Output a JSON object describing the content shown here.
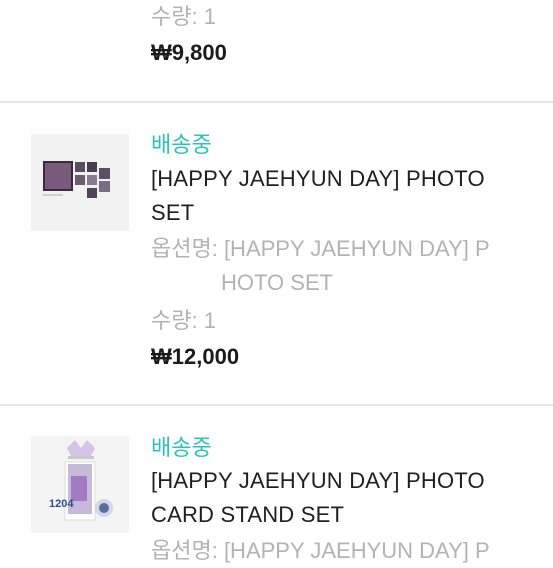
{
  "items": [
    {
      "quantity": "수량: 1",
      "price": "₩9,800"
    },
    {
      "status": "배송중",
      "title_line1": "[HAPPY JAEHYUN DAY] PHOTO",
      "title_line2": "SET",
      "option_line1": "옵션명: [HAPPY JAEHYUN DAY] P",
      "option_line2": "HOTO SET",
      "quantity": "수량: 1",
      "price": "₩12,000",
      "thumbnail_icon": "photo-set-thumbnail"
    },
    {
      "status": "배송중",
      "title_line1": "[HAPPY JAEHYUN DAY] PHOTO",
      "title_line2": "CARD STAND SET",
      "option_line1": "옵션명: [HAPPY JAEHYUN DAY] P",
      "thumbnail_icon": "photo-card-stand-thumbnail",
      "thumbnail_text": "1204"
    }
  ],
  "colors": {
    "status": "#2cc3b8",
    "muted": "#b3b3b3",
    "divider": "#e6e6e6"
  }
}
